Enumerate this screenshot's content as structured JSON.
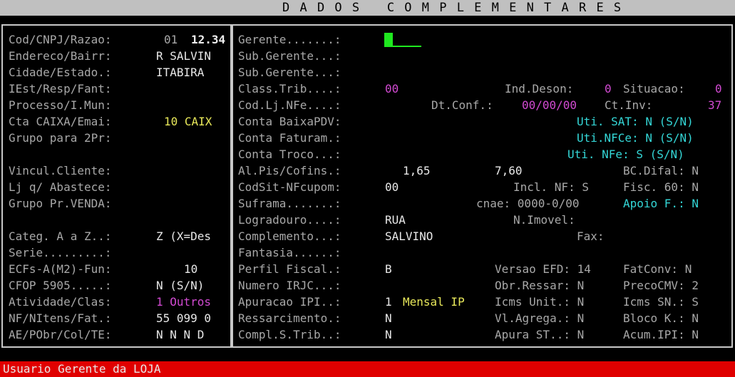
{
  "title": "D A D O S   C O M P L E M E N T A R E S",
  "status": "Usuario Gerente da LOJA",
  "left": [
    {
      "label": "Cod/CNPJ/Razao:",
      "value": "01",
      "value2": "12.34"
    },
    {
      "label": "Endereco/Bairr:",
      "value": "R SALVIN"
    },
    {
      "label": "Cidade/Estado.:",
      "value": "ITABIRA"
    },
    {
      "label": "IEst/Resp/Fant:",
      "value": ""
    },
    {
      "label": "Processo/I.Mun:",
      "value": ""
    },
    {
      "label": "Cta CAIXA/Emai:",
      "value": "10 CAIX"
    },
    {
      "label": "Grupo para 2Pr:",
      "value": ""
    },
    {
      "label": "Vincul.Cliente:",
      "value": ""
    },
    {
      "label": "Lj q/ Abastece:",
      "value": ""
    },
    {
      "label": "Grupo Pr.VENDA:",
      "value": ""
    },
    {
      "label": "Categ. A a Z..:",
      "value": "Z (X=Des"
    },
    {
      "label": "Serie.........:",
      "value": ""
    },
    {
      "label": "ECFs-A(M2)-Fun:",
      "value": "10"
    },
    {
      "label": "CFOP 5905.....:",
      "value": "N (S/N)"
    },
    {
      "label": "Atividade/Clas:",
      "value": "1 Outros"
    },
    {
      "label": "NF/NItens/Fat.:",
      "value": "55 099 0"
    },
    {
      "label": "AE/PObr/Col/TE:",
      "value": "N N N D"
    }
  ],
  "right": {
    "gerente": "Gerente.......:",
    "sub_gerente": "Sub.Gerente...:",
    "class_trib": "Class.Trib....:",
    "class_trib_val": "00",
    "ind_deson": "Ind.Deson:",
    "ind_deson_val": "0",
    "situacao": "Situacao:",
    "situacao_val": "0",
    "cod_lj": "Cod.Lj.NFe....:",
    "dt_conf": "Dt.Conf.:",
    "dt_conf_val": "00/00/00",
    "ct_inv": "Ct.Inv:",
    "ct_inv_val": "37",
    "conta_baixa": "Conta BaixaPDV:",
    "uti_sat": "Uti. SAT: N (S/N)",
    "conta_faturam": "Conta Faturam.:",
    "uti_nfce": "Uti.NFCe: N (S/N)",
    "conta_troco": "Conta Troco...:",
    "uti_nfe": "Uti. NFe: S (S/N)",
    "al_pis": "Al.Pis/Cofins.:",
    "al_pis_val1": "1,65",
    "al_pis_val2": "7,60",
    "bc_difal": "BC.Difal: N",
    "codsit": "CodSit-NFcupom:",
    "codsit_val": "00",
    "incl_nf": "Incl. NF: S",
    "fisc60": "Fisc. 60: N",
    "suframa": "Suframa.......:",
    "cnae": "cnae: 0000-0/00",
    "apoio": "Apoio F.: N",
    "logradouro": "Logradouro....:",
    "logradouro_val": "RUA",
    "n_imovel": "N.Imovel:",
    "complemento": "Complemento...:",
    "complemento_val": "SALVINO",
    "fax": "Fax:",
    "fantasia": "Fantasia......:",
    "perfil": "Perfil Fiscal.:",
    "perfil_val": "B",
    "versao_efd": "Versao EFD: 14",
    "fatconv": "FatConv: N",
    "numero_irjc": "Numero IRJC...:",
    "obr_ressar": "Obr.Ressar: N",
    "precocmv": "PrecoCMV: 2",
    "apuracao": "Apuracao IPI..:",
    "apuracao_val1": "1",
    "apuracao_val2": "Mensal IP",
    "icms_unit": "Icms Unit.: N",
    "icms_sn": "Icms SN.: S",
    "ressarcimento": "Ressarcimento.:",
    "ressarcimento_val": "N",
    "vl_agrega": "Vl.Agrega.: N",
    "bloco_k": "Bloco K.: N",
    "compl_strib": "Compl.S.Trib..:",
    "compl_strib_val": "N",
    "apura_st": "Apura ST..: N",
    "acum_ipi": "Acum.IPI: N"
  },
  "colors": {
    "title_bg": "#c0c0c0",
    "status_bg": "#e00000",
    "cursor": "#1fe81f",
    "label": "#a8a8a8",
    "yellow": "#e8e85a",
    "magenta": "#d24ad2",
    "cyan": "#34d7d7"
  }
}
